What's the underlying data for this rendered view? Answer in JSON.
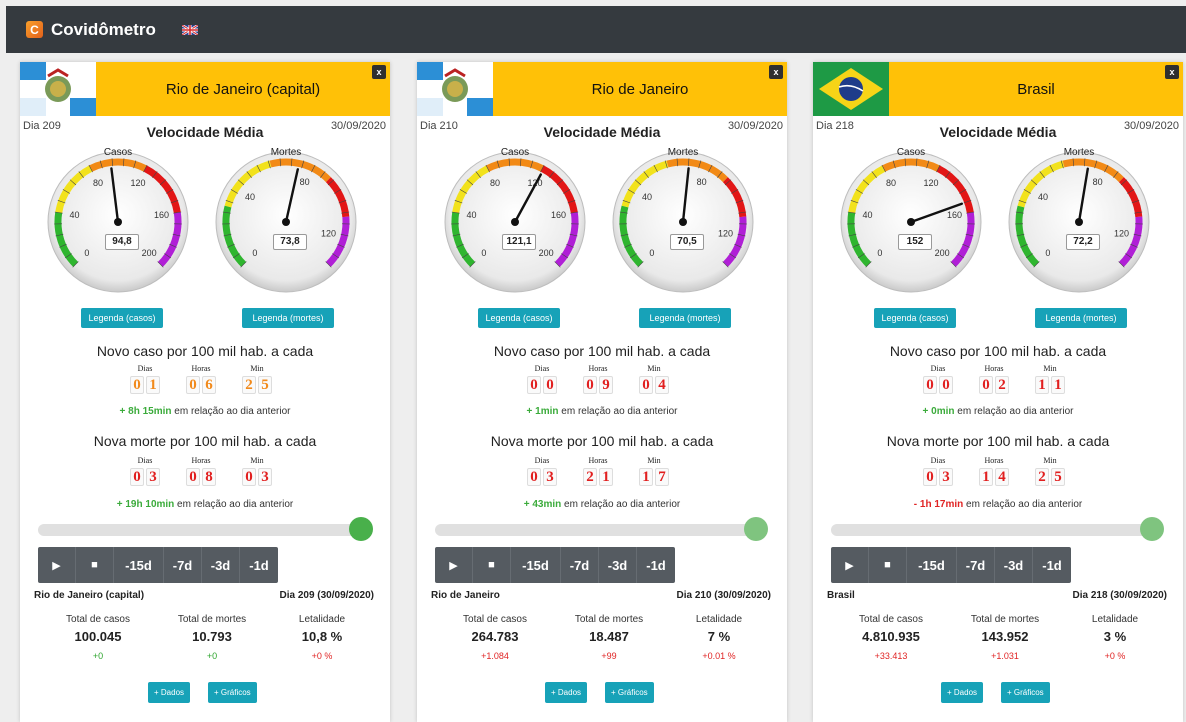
{
  "app": {
    "title": "Covidômetro"
  },
  "cards": [
    {
      "title": "Rio de Janeiro (capital)",
      "close": "x",
      "day_label": "Dia 209",
      "date": "30/09/2020",
      "speed_title": "Velocidade Média",
      "cases_gauge": {
        "label": "Casos",
        "value": 94.8,
        "display": "94,8",
        "ticks": [
          "0",
          "40",
          "80",
          "120",
          "160",
          "200"
        ]
      },
      "deaths_gauge": {
        "label": "Mortes",
        "value": 73.8,
        "display": "73,8",
        "ticks": [
          "0",
          "40",
          "80",
          "120"
        ]
      },
      "legend_cases": "Legenda (casos)",
      "legend_deaths": "Legenda (mortes)",
      "new_case_title": "Novo caso por 100 mil hab. a cada",
      "new_case": {
        "dias": "01",
        "horas": "06",
        "min": "25",
        "color": "#f18a1c"
      },
      "case_delta": {
        "sign": "+",
        "amount": "8h 15min",
        "text": "em relação ao dia anterior",
        "color": "#3bab3b"
      },
      "new_death_title": "Nova morte por 100 mil hab. a cada",
      "new_death": {
        "dias": "03",
        "horas": "08",
        "min": "03",
        "color": "#e11f1f"
      },
      "death_delta": {
        "sign": "+",
        "amount": "19h 10min",
        "text": "em relação ao dia anterior",
        "color": "#3bab3b"
      },
      "place": "Rio de Janeiro (capital)",
      "day_full": "Dia 209 (30/09/2020)",
      "stats": [
        {
          "label": "Total de casos",
          "value": "100.045",
          "delta": "+0",
          "color": "#2ea52e"
        },
        {
          "label": "Total de mortes",
          "value": "10.793",
          "delta": "+0",
          "color": "#2ea52e"
        },
        {
          "label": "Letalidade",
          "value": "10,8 %",
          "delta": "+0 %",
          "color": "#e02424"
        }
      ],
      "flag": "rj"
    },
    {
      "title": "Rio de Janeiro",
      "close": "x",
      "day_label": "Dia 210",
      "date": "30/09/2020",
      "speed_title": "Velocidade Média",
      "cases_gauge": {
        "label": "Casos",
        "value": 121.1,
        "display": "121,1",
        "ticks": [
          "0",
          "40",
          "80",
          "120",
          "160",
          "200"
        ]
      },
      "deaths_gauge": {
        "label": "Mortes",
        "value": 70.5,
        "display": "70,5",
        "ticks": [
          "0",
          "40",
          "80",
          "120"
        ]
      },
      "legend_cases": "Legenda (casos)",
      "legend_deaths": "Legenda (mortes)",
      "new_case_title": "Novo caso por 100 mil hab. a cada",
      "new_case": {
        "dias": "00",
        "horas": "09",
        "min": "04",
        "color": "#e11f1f"
      },
      "case_delta": {
        "sign": "+",
        "amount": "1min",
        "text": "em relação ao dia anterior",
        "color": "#3bab3b"
      },
      "new_death_title": "Nova morte por 100 mil hab. a cada",
      "new_death": {
        "dias": "03",
        "horas": "21",
        "min": "17",
        "color": "#e11f1f"
      },
      "death_delta": {
        "sign": "+",
        "amount": "43min",
        "text": "em relação ao dia anterior",
        "color": "#3bab3b"
      },
      "place": "Rio de Janeiro",
      "day_full": "Dia 210 (30/09/2020)",
      "stats": [
        {
          "label": "Total de casos",
          "value": "264.783",
          "delta": "+1.084",
          "color": "#e02424"
        },
        {
          "label": "Total de mortes",
          "value": "18.487",
          "delta": "+99",
          "color": "#e02424"
        },
        {
          "label": "Letalidade",
          "value": "7 %",
          "delta": "+0.01 %",
          "color": "#e02424"
        }
      ],
      "flag": "rj"
    },
    {
      "title": "Brasil",
      "close": "x",
      "day_label": "Dia 218",
      "date": "30/09/2020",
      "speed_title": "Velocidade Média",
      "cases_gauge": {
        "label": "Casos",
        "value": 152,
        "display": "152",
        "ticks": [
          "0",
          "40",
          "80",
          "120",
          "160",
          "200"
        ]
      },
      "deaths_gauge": {
        "label": "Mortes",
        "value": 72.2,
        "display": "72,2",
        "ticks": [
          "0",
          "40",
          "80",
          "120"
        ]
      },
      "legend_cases": "Legenda (casos)",
      "legend_deaths": "Legenda (mortes)",
      "new_case_title": "Novo caso por 100 mil hab. a cada",
      "new_case": {
        "dias": "00",
        "horas": "02",
        "min": "11",
        "color": "#e11f1f"
      },
      "case_delta": {
        "sign": "+",
        "amount": "0min",
        "text": "em relação ao dia anterior",
        "color": "#3bab3b"
      },
      "new_death_title": "Nova morte por 100 mil hab. a cada",
      "new_death": {
        "dias": "03",
        "horas": "14",
        "min": "25",
        "color": "#e11f1f"
      },
      "death_delta": {
        "sign": "-",
        "amount": "1h 17min",
        "text": "em relação ao dia anterior",
        "color": "#e02424"
      },
      "place": "Brasil",
      "day_full": "Dia 218 (30/09/2020)",
      "stats": [
        {
          "label": "Total de casos",
          "value": "4.810.935",
          "delta": "+33.413",
          "color": "#e02424"
        },
        {
          "label": "Total de mortes",
          "value": "143.952",
          "delta": "+1.031",
          "color": "#e02424"
        },
        {
          "label": "Letalidade",
          "value": "3 %",
          "delta": "+0 %",
          "color": "#e02424"
        }
      ],
      "flag": "br"
    }
  ],
  "counter_labels": {
    "dias": "Dias",
    "horas": "Horas",
    "min": "Min"
  },
  "player": [
    "▶",
    "■",
    "-15d",
    "-7d",
    "-3d",
    "-1d"
  ],
  "buttons": {
    "dados": "+ Dados",
    "graficos": "+ Gráficos"
  },
  "colors": {
    "navbar": "#353a3f",
    "title_bar": "#ffc107",
    "teal": "#17a2b8",
    "slider": "#49b04b"
  }
}
